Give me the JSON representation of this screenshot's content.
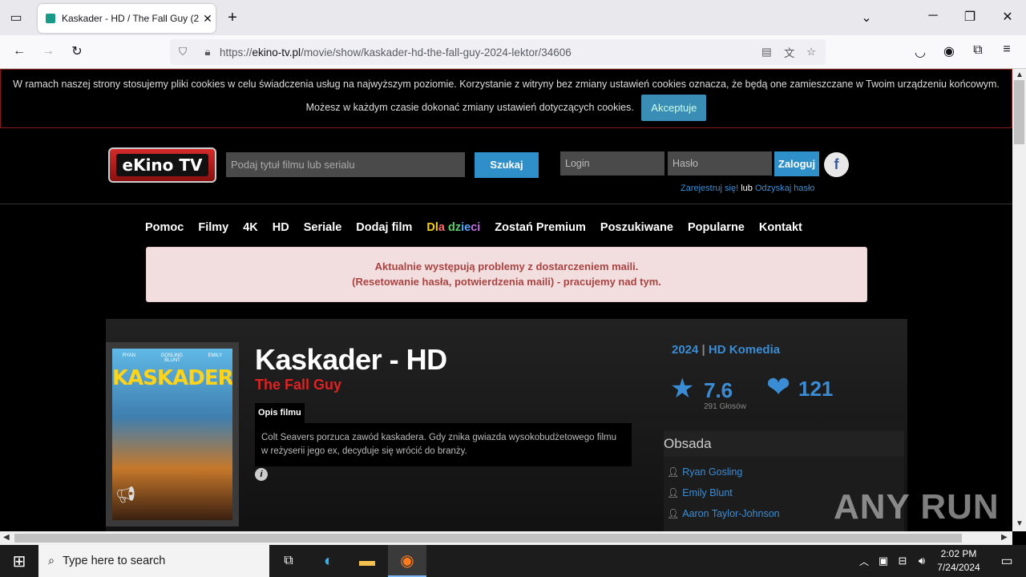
{
  "browser": {
    "tab_title": "Kaskader - HD / The Fall Guy (2",
    "url_prefix": "https://",
    "url_host": "ekino-tv.pl",
    "url_path": "/movie/show/kaskader-hd-the-fall-guy-2024-lektor/34606"
  },
  "cookie": {
    "text": "W ramach naszej strony stosujemy pliki cookies w celu świadczenia usług na najwyższym poziomie. Korzystanie z witryny bez zmiany ustawień cookies oznacza, że będą one zamieszczane w Twoim urządzeniu końcowym. Możesz w każdym czasie dokonać zmiany ustawień dotyczących cookies.",
    "accept_label": "Akceptuje"
  },
  "header": {
    "logo_text": "eKino TV",
    "search_placeholder": "Podaj tytuł filmu lub serialu",
    "search_button": "Szukaj",
    "login_placeholder": "Login",
    "password_placeholder": "Hasło",
    "login_button": "Zaloguj",
    "facebook_letter": "f",
    "register_link": "Zarejestruj się!",
    "or_text": "lub",
    "recover_link": "Odzyskaj hasło"
  },
  "menu": {
    "items": [
      "Pomoc",
      "Filmy",
      "4K",
      "HD",
      "Seriale",
      "Dodaj film"
    ],
    "kids": [
      "Dl",
      "a",
      " dz",
      "ie",
      "ci"
    ],
    "items_after": [
      "Zostań Premium",
      "Poszukiwane",
      "Popularne",
      "Kontakt"
    ]
  },
  "alert": {
    "line1": "Aktualnie występują problemy z dostarczeniem maili.",
    "line2": "(Resetowanie hasła, potwierdzenia maili) - pracujemy nad tym."
  },
  "movie": {
    "title": "Kaskader - HD",
    "original_title": "The Fall Guy",
    "poster_title": "KASKADER",
    "poster_names": "RYAN GOSLING EMILY BLUNT",
    "description_tab": "Opis filmu",
    "description": "Colt Seavers porzuca zawód kaskadera. Gdy znika gwiazda wysokobudżetowego filmu w reżyserii jego ex, decyduje się wrócić do branży.",
    "year": "2024",
    "separator": "|",
    "genre": "HD Komedia",
    "rating": "7.6",
    "votes": "291 Głosów",
    "likes": "121",
    "cast_title": "Obsada",
    "cast": [
      "Ryan Gosling",
      "Emily Blunt",
      "Aaron Taylor-Johnson"
    ]
  },
  "taskbar": {
    "search_placeholder": "Type here to search",
    "time": "2:02 PM",
    "date": "7/24/2024"
  },
  "watermark": "ANY RUN"
}
